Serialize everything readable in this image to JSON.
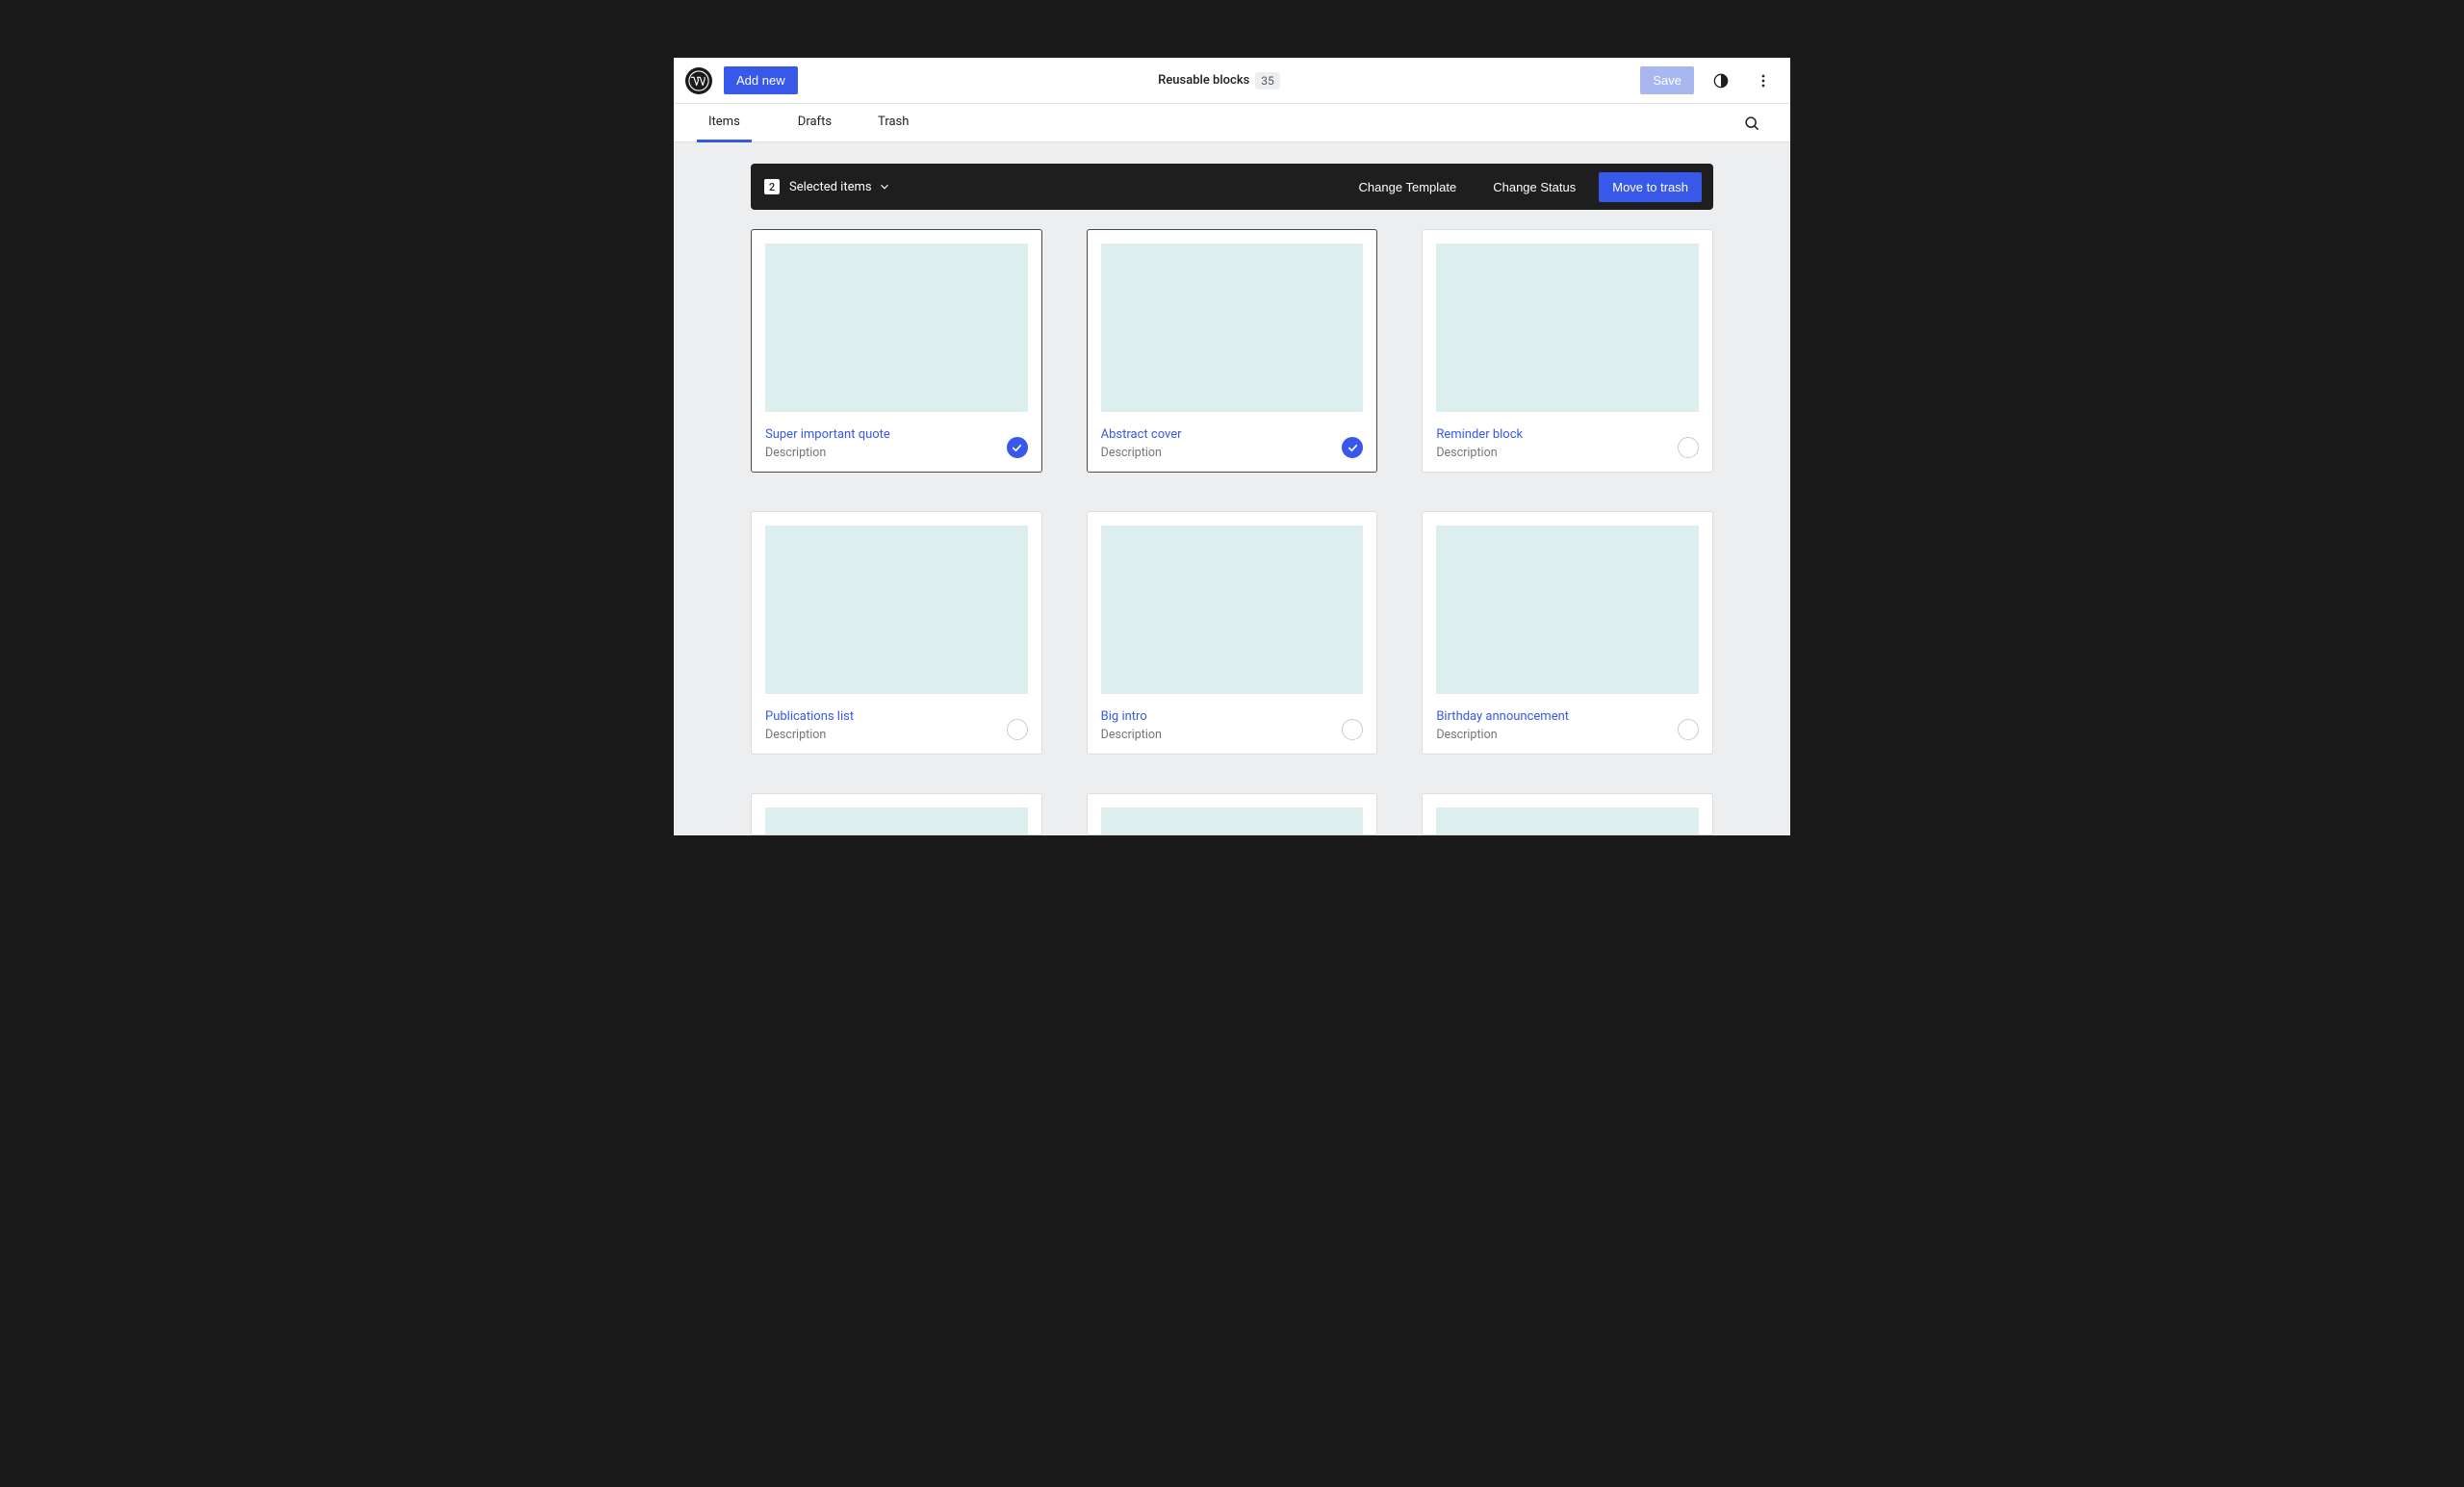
{
  "topbar": {
    "add_new_label": "Add new",
    "title": "Reusable blocks",
    "count": "35",
    "save_label": "Save"
  },
  "tabs": [
    {
      "label": "Items",
      "active": true
    },
    {
      "label": "Drafts",
      "active": false
    },
    {
      "label": "Trash",
      "active": false
    }
  ],
  "selection": {
    "count": "2",
    "label": "Selected items",
    "actions": {
      "change_template": "Change Template",
      "change_status": "Change Status",
      "move_to_trash": "Move to trash"
    }
  },
  "cards": [
    {
      "title": "Super important quote",
      "desc": "Description",
      "selected": true
    },
    {
      "title": "Abstract cover",
      "desc": "Description",
      "selected": true
    },
    {
      "title": "Reminder block",
      "desc": "Description",
      "selected": false
    },
    {
      "title": "Publications list",
      "desc": "Description",
      "selected": false
    },
    {
      "title": "Big intro",
      "desc": "Description",
      "selected": false
    },
    {
      "title": "Birthday announcement",
      "desc": "Description",
      "selected": false
    }
  ]
}
